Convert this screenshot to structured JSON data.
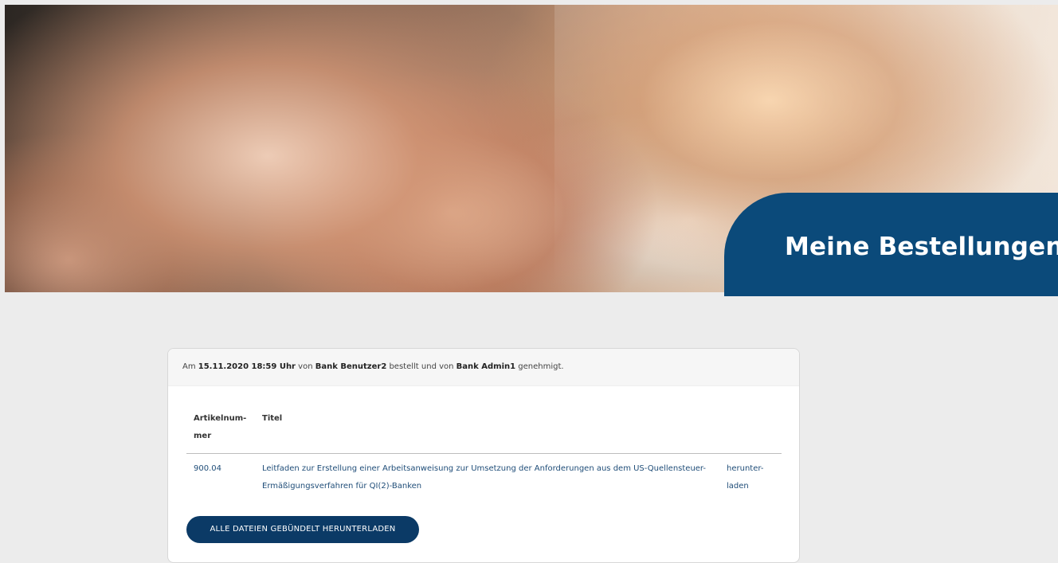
{
  "header": {
    "title": "Meine Bestellungen"
  },
  "order": {
    "prefix": "Am ",
    "datetime": "15.11.2020 18:59 Uhr",
    "by_label": " von ",
    "ordered_by": "Bank Benutzer2",
    "approved_text": " bestellt und von ",
    "approved_by": "Bank Admin1",
    "suffix": " genehmigt."
  },
  "table": {
    "columns": [
      "Artikelnum-\nmer",
      "Titel"
    ],
    "rows": [
      {
        "article": "900.04",
        "title": "Leitfaden zur Erstellung einer Arbeitsanweisung zur Umsetzung der Anforderungen aus dem US-Quellensteuer-Ermäßigungsverfahren für QI(2)-Banken",
        "download_label": "herunter-\nladen"
      }
    ]
  },
  "actions": {
    "bundle_download": "ALLE DATEIEN GEBÜNDELT HERUNTERLADEN"
  },
  "colors": {
    "brand_blue": "#0b4a7a",
    "button_blue": "#0b3a66",
    "link_blue": "#1f4d78",
    "page_bg": "#ececec"
  }
}
